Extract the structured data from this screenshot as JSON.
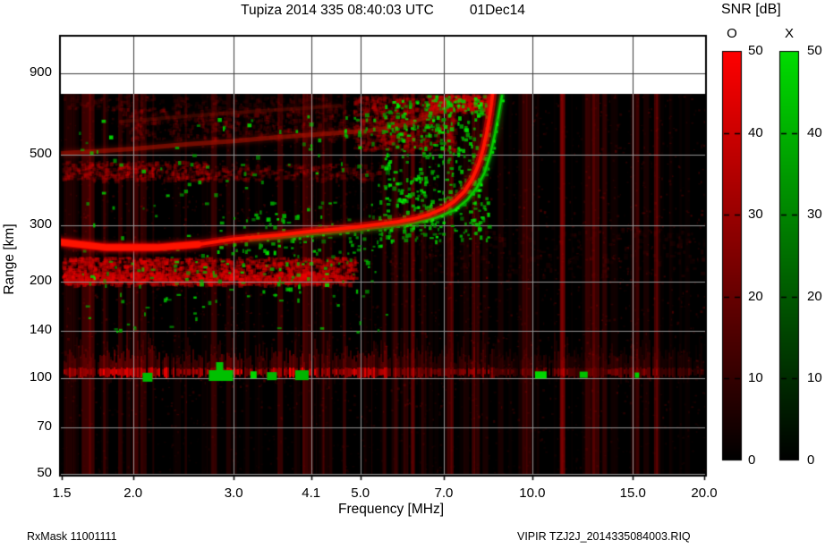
{
  "header": {
    "title": "Tupiza 2014 335 08:40:03 UTC",
    "date": "01Dec14"
  },
  "footer": {
    "left": "RxMask 11001111",
    "right": "VIPIR  TZJ2J_2014335084003.RIQ"
  },
  "chart_data": {
    "type": "heatmap",
    "title": "Tupiza 2014 335 08:40:03 UTC",
    "date": "01Dec14",
    "station": "Tupiza",
    "xlabel": "Frequency [MHz]",
    "ylabel": "Range [km]",
    "x_scale": "log",
    "y_scale": "log",
    "x_ticks": [
      "1.5",
      "2.0",
      "3.0",
      "4.1",
      "5.0",
      "7.0",
      "10.0",
      "15.0",
      "20.0"
    ],
    "x_tick_values": [
      1.5,
      2.0,
      3.0,
      4.1,
      5.0,
      7.0,
      10.0,
      15.0,
      20.0
    ],
    "y_ticks": [
      "900",
      "500",
      "300",
      "200",
      "140",
      "100",
      "70",
      "50"
    ],
    "y_tick_values": [
      900,
      500,
      300,
      200,
      140,
      100,
      70,
      50
    ],
    "x_range_mhz": [
      1.5,
      20
    ],
    "y_range_km": [
      50,
      1190
    ],
    "data_top_km": 775,
    "grid": true,
    "background_color": "#000000",
    "legend": {
      "title": "SNR [dB]",
      "position": "right",
      "ticks": [
        "50",
        "40",
        "30",
        "20",
        "10",
        "0"
      ],
      "tick_values": [
        50,
        40,
        30,
        20,
        10,
        0
      ],
      "bars": [
        {
          "label": "O",
          "mode": "O-mode",
          "color_top": "#ff0000",
          "color_bottom": "#000000"
        },
        {
          "label": "X",
          "mode": "X-mode",
          "color_top": "#00dd00",
          "color_bottom": "#000000"
        }
      ]
    },
    "series": [
      {
        "name": "F-region O-mode trace",
        "color": "#e00000",
        "core": "#ff1500",
        "width": 9,
        "alpha": 0.55,
        "thick_left": 2.7,
        "points_f_km": [
          [
            1.5,
            266
          ],
          [
            1.8,
            256
          ],
          [
            2.2,
            256
          ],
          [
            2.6,
            262
          ],
          [
            3.0,
            272
          ],
          [
            3.6,
            280
          ],
          [
            4.1,
            288
          ],
          [
            4.6,
            293
          ],
          [
            5.0,
            298
          ],
          [
            5.4,
            303
          ],
          [
            5.8,
            308
          ],
          [
            6.2,
            315
          ],
          [
            6.6,
            325
          ],
          [
            7.0,
            340
          ],
          [
            7.3,
            357
          ],
          [
            7.6,
            383
          ],
          [
            7.85,
            420
          ],
          [
            8.05,
            465
          ],
          [
            8.2,
            520
          ],
          [
            8.33,
            590
          ],
          [
            8.42,
            660
          ],
          [
            8.48,
            720
          ],
          [
            8.52,
            775
          ]
        ]
      },
      {
        "name": "F-region X-mode trace",
        "color": "#00a000",
        "core": "#00d400",
        "width": 6,
        "alpha": 0.5,
        "dotted": true,
        "points_f_km": [
          [
            3.2,
            272
          ],
          [
            3.8,
            278
          ],
          [
            4.4,
            285
          ],
          [
            5.0,
            292
          ],
          [
            5.6,
            298
          ],
          [
            6.2,
            306
          ],
          [
            6.8,
            318
          ],
          [
            7.3,
            335
          ],
          [
            7.7,
            362
          ],
          [
            8.0,
            395
          ],
          [
            8.25,
            440
          ],
          [
            8.45,
            505
          ],
          [
            8.6,
            580
          ],
          [
            8.72,
            660
          ],
          [
            8.8,
            725
          ],
          [
            8.85,
            765
          ]
        ]
      },
      {
        "name": "O-mode second hop",
        "color": "#b41200",
        "width": 5,
        "alpha": 0.5,
        "points_f_km": [
          [
            1.5,
            505
          ],
          [
            2.0,
            522
          ],
          [
            2.5,
            540
          ],
          [
            3.0,
            552
          ],
          [
            3.5,
            566
          ],
          [
            4.1,
            578
          ],
          [
            4.7,
            588
          ],
          [
            5.2,
            596
          ],
          [
            5.7,
            610
          ],
          [
            6.2,
            635
          ],
          [
            6.6,
            662
          ],
          [
            6.9,
            692
          ],
          [
            7.1,
            720
          ]
        ]
      },
      {
        "name": "O-mode third hop",
        "color": "#821000",
        "width": 4,
        "alpha": 0.32,
        "points_f_km": [
          [
            1.9,
            635
          ],
          [
            2.6,
            665
          ],
          [
            3.3,
            685
          ],
          [
            4.0,
            700
          ],
          [
            4.6,
            712
          ]
        ]
      }
    ],
    "regions": [
      {
        "name": "sub-trace echo band",
        "color": "red",
        "f": [
          1.5,
          4.9
        ],
        "km": [
          198,
          240
        ],
        "n": 1500,
        "alpha": 0.5
      },
      {
        "name": "sub-trace band core",
        "color": "red",
        "f": [
          1.5,
          4.6
        ],
        "km": [
          200,
          214
        ],
        "n": 500,
        "alpha": 0.6
      },
      {
        "name": "second-hop band",
        "color": "red",
        "f": [
          1.5,
          5.4
        ],
        "km": [
          420,
          470
        ],
        "n": 450,
        "alpha": 0.25
      },
      {
        "name": "second-hop band left",
        "color": "red",
        "f": [
          1.5,
          2.7
        ],
        "km": [
          420,
          480
        ],
        "n": 220,
        "alpha": 0.35
      },
      {
        "name": "upper multiples",
        "color": "red",
        "f": [
          1.9,
          5.6
        ],
        "km": [
          560,
          705
        ],
        "n": 450,
        "alpha": 0.2
      },
      {
        "name": "upper-left faint top",
        "color": "red",
        "f": [
          1.5,
          5.5
        ],
        "km": [
          700,
          770
        ],
        "n": 200,
        "alpha": 0.12
      },
      {
        "name": "diffuse cloud near foF2",
        "color": "red",
        "f": [
          4.85,
          7.3
        ],
        "km": [
          520,
          770
        ],
        "n": 800,
        "alpha": 0.28
      },
      {
        "name": "top streak",
        "color": "red",
        "f": [
          6.5,
          8.45
        ],
        "km": [
          690,
          775
        ],
        "n": 300,
        "alpha": 0.5
      },
      {
        "name": "right dim mottle",
        "color": "red",
        "f": [
          5.6,
          20
        ],
        "km": [
          210,
          300
        ],
        "n": 250,
        "alpha": 0.1
      },
      {
        "name": "green speckle blob",
        "color": "green",
        "f": [
          5.5,
          8.35
        ],
        "km": [
          270,
          745
        ],
        "n": 430,
        "alpha": 0.9
      },
      {
        "name": "green scatter left",
        "color": "green",
        "f": [
          1.6,
          5.6
        ],
        "km": [
          140,
          670
        ],
        "n": 170,
        "alpha": 0.85
      },
      {
        "name": "green along trace",
        "color": "green",
        "f": [
          2.8,
          5.6
        ],
        "km": [
          245,
          330
        ],
        "n": 90,
        "alpha": 0.85
      },
      {
        "name": "green top specks",
        "color": "green",
        "f": [
          6.4,
          8.3
        ],
        "km": [
          690,
          770
        ],
        "n": 45,
        "alpha": 0.85
      },
      {
        "name": "green below 200 km",
        "color": "green",
        "f": [
          1.8,
          5.2
        ],
        "km": [
          172,
          200
        ],
        "n": 16,
        "alpha": 0.8
      },
      {
        "name": "green near second hop",
        "color": "green",
        "f": [
          4.5,
          6.9
        ],
        "km": [
          560,
          700
        ],
        "n": 30,
        "alpha": 0.85
      },
      {
        "name": "green on sub band",
        "color": "green",
        "f": [
          1.7,
          5.3
        ],
        "km": [
          198,
          245
        ],
        "n": 45,
        "alpha": 0.8
      }
    ],
    "e_region": {
      "center_km": 105,
      "segments": [
        [
          1.5,
          1.72,
          0.6
        ],
        [
          1.72,
          2.3,
          0.85
        ],
        [
          2.3,
          2.75,
          0.65
        ],
        [
          2.75,
          3.1,
          0.85
        ],
        [
          3.1,
          3.55,
          0.7
        ],
        [
          3.55,
          4.15,
          0.9
        ],
        [
          4.15,
          5.0,
          0.75
        ],
        [
          5.0,
          5.6,
          0.8
        ],
        [
          5.6,
          6.2,
          0.5
        ],
        [
          6.2,
          7.2,
          0.45
        ],
        [
          7.2,
          8.6,
          0.55
        ],
        [
          8.6,
          10.0,
          0.35
        ],
        [
          10.0,
          11.5,
          0.5
        ],
        [
          11.5,
          13.5,
          0.3
        ],
        [
          13.5,
          16.5,
          0.45
        ],
        [
          16.5,
          20,
          0.3
        ]
      ],
      "green_patches": [
        [
          2.12,
          11,
          10
        ],
        [
          2.85,
          27,
          12
        ],
        [
          3.25,
          7,
          8
        ],
        [
          3.5,
          11,
          9
        ],
        [
          3.95,
          15,
          11
        ],
        [
          10.35,
          13,
          8
        ],
        [
          12.3,
          9,
          7
        ],
        [
          15.25,
          5,
          6
        ]
      ]
    },
    "noise": {
      "seed": 20141201,
      "stripes": 130,
      "gaps": 22,
      "specks": 3000
    }
  }
}
